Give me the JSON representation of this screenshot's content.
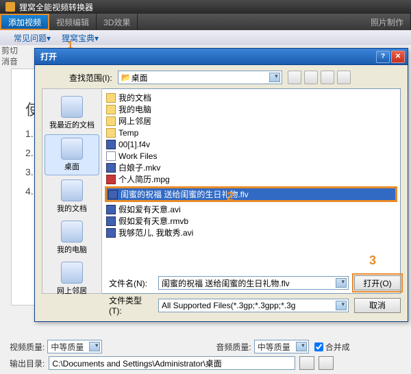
{
  "app": {
    "title": "狸窝全能视频转换器"
  },
  "toolbar": {
    "addVideo": "添加视频",
    "videoEdit": "视频编辑",
    "effect3d": "3D效果",
    "photoMake": "照片制作"
  },
  "links": {
    "faq": "常见问题▾",
    "dict": "狸窝宝典▾"
  },
  "annotations": {
    "n1": "1",
    "n2": "2",
    "n3": "3"
  },
  "leftLabels": {
    "cut": "剪切",
    "mute": "消音"
  },
  "mainText": {
    "line1": "使",
    "line2": "1. ",
    "line3": "2. ",
    "line4": "3. ",
    "line5": "4. "
  },
  "bottom": {
    "vqLabel": "视频质量:",
    "vqValue": "中等质量",
    "aqLabel": "音频质量:",
    "aqValue": "中等质量",
    "mergeLabel": "合并成"
  },
  "output": {
    "label": "输出目录:",
    "path": "C:\\Documents and Settings\\Administrator\\桌面"
  },
  "dialog": {
    "title": "打开",
    "lookinLabel": "查找范围(I):",
    "lookinValue": "桌面",
    "places": {
      "recent": "我最近的文档",
      "desktop": "桌面",
      "mydocs": "我的文档",
      "mycomp": "我的电脑",
      "network": "网上邻居"
    },
    "files": [
      {
        "name": "我的文档",
        "type": "folder"
      },
      {
        "name": "我的电脑",
        "type": "folder"
      },
      {
        "name": "网上邻居",
        "type": "folder"
      },
      {
        "name": "Temp",
        "type": "folder"
      },
      {
        "name": "00[1].f4v",
        "type": "vid"
      },
      {
        "name": "Work Files",
        "type": "doc"
      },
      {
        "name": "白娘子.mkv",
        "type": "vid"
      },
      {
        "name": "个人简历.mpg",
        "type": "img"
      },
      {
        "name": "闺蜜的祝福 送给闺蜜的生日礼物.flv",
        "type": "vid",
        "selected": true
      },
      {
        "name": "假如爱有天意.avi",
        "type": "vid"
      },
      {
        "name": "假如爱有天意.rmvb",
        "type": "vid"
      },
      {
        "name": "我够范儿, 我敢秀.avi",
        "type": "vid"
      }
    ],
    "filenameLabel": "文件名(N):",
    "filenameValue": "闺蜜的祝福 送给闺蜜的生日礼物.flv",
    "filetypeLabel": "文件类型(T):",
    "filetypeValue": "All Supported Files(*.3gp;*.3gpp;*.3g",
    "openBtn": "打开(O)",
    "cancelBtn": "取消"
  }
}
